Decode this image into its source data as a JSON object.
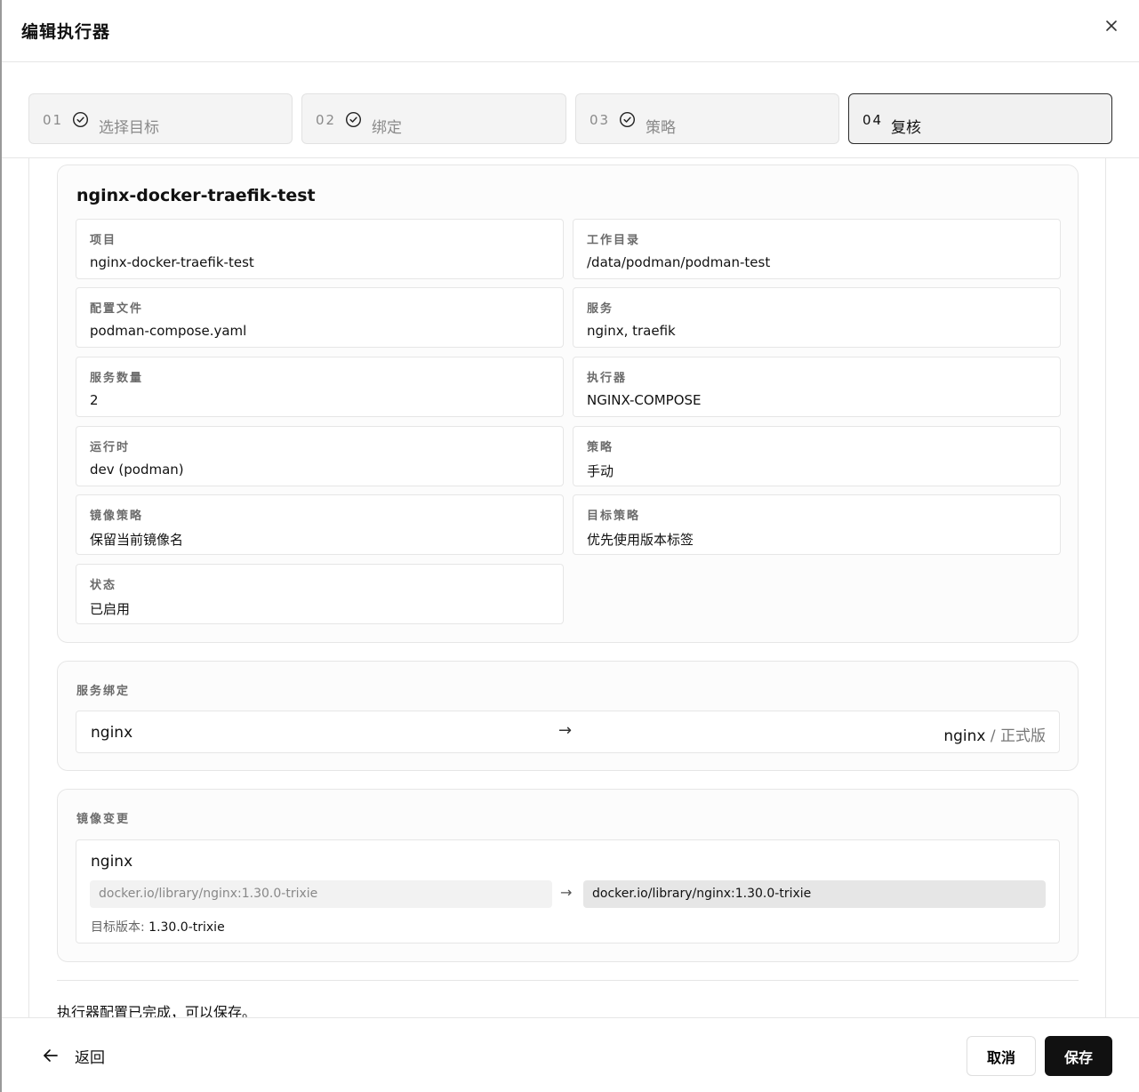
{
  "dialog": {
    "title": "编辑执行器"
  },
  "steps": [
    {
      "num": "01",
      "label": "选择目标",
      "completed": true
    },
    {
      "num": "02",
      "label": "绑定",
      "completed": true
    },
    {
      "num": "03",
      "label": "策略",
      "completed": true
    },
    {
      "num": "04",
      "label": "复核",
      "completed": false,
      "active": true
    }
  ],
  "summary": {
    "title": "nginx-docker-traefik-test",
    "fields": [
      {
        "key": "项目",
        "value": "nginx-docker-traefik-test"
      },
      {
        "key": "工作目录",
        "value": "/data/podman/podman-test"
      },
      {
        "key": "配置文件",
        "value": "podman-compose.yaml"
      },
      {
        "key": "服务",
        "value": "nginx, traefik"
      },
      {
        "key": "服务数量",
        "value": "2"
      },
      {
        "key": "执行器",
        "value": "NGINX-COMPOSE"
      },
      {
        "key": "运行时",
        "value": "dev (podman)"
      },
      {
        "key": "策略",
        "value": "手动"
      },
      {
        "key": "镜像策略",
        "value": "保留当前镜像名"
      },
      {
        "key": "目标策略",
        "value": "优先使用版本标签"
      },
      {
        "key": "状态",
        "value": "已启用"
      }
    ]
  },
  "binding": {
    "label": "服务绑定",
    "source": "nginx",
    "arrow": "→",
    "target": "nginx",
    "target_tag": "/ 正式版"
  },
  "image_change": {
    "label": "镜像变更",
    "service": "nginx",
    "old_image": "docker.io/library/nginx:1.30.0-trixie",
    "arrow": "→",
    "new_image": "docker.io/library/nginx:1.30.0-trixie",
    "target_version_label": "目标版本:",
    "target_version": "1.30.0-trixie"
  },
  "status_message": "执行器配置已完成，可以保存。",
  "footer": {
    "back_label": "返回",
    "cancel_label": "取消",
    "save_label": "保存"
  }
}
